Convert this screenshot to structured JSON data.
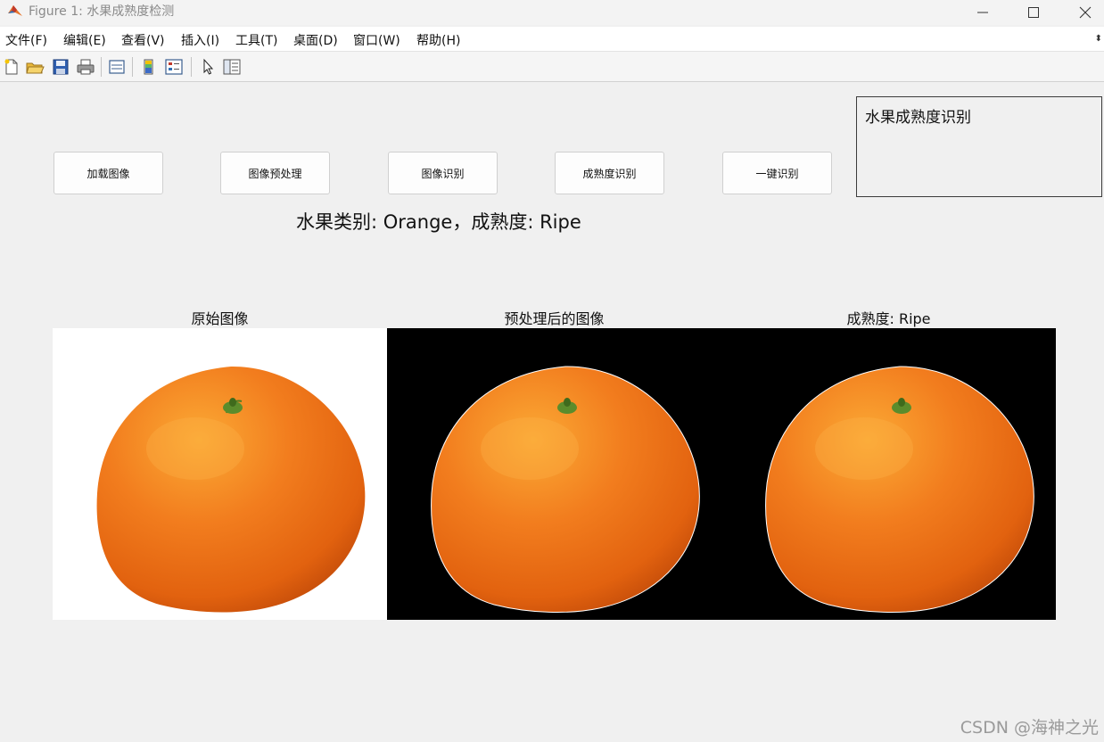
{
  "window": {
    "title": "Figure 1: 水果成熟度检测",
    "logo_icon": "matlab-logo-icon",
    "controls": [
      "minimize-icon",
      "maximize-icon",
      "close-icon"
    ]
  },
  "menu": {
    "items": [
      "文件(F)",
      "编辑(E)",
      "查看(V)",
      "插入(I)",
      "工具(T)",
      "桌面(D)",
      "窗口(W)",
      "帮助(H)"
    ],
    "overflow_glyph": "⬍"
  },
  "toolbar": {
    "icons": [
      "new-figure-icon",
      "open-file-icon",
      "save-icon",
      "print-icon",
      "link-plot-icon",
      "colorbar-icon",
      "legend-icon",
      "pointer-icon",
      "property-editor-icon"
    ]
  },
  "buttons": {
    "load_image": "加载图像",
    "preprocess": "图像预处理",
    "recognize": "图像识别",
    "ripeness": "成熟度识别",
    "one_click": "一键识别"
  },
  "info_box": {
    "text": "水果成熟度识别"
  },
  "result": {
    "text": "水果类别: Orange，成熟度: Ripe"
  },
  "axes": {
    "original_title": "原始图像",
    "preprocessed_title": "预处理后的图像",
    "ripeness_title": "成熟度: Ripe"
  },
  "colors": {
    "orange_fill": "#f07a1c",
    "orange_highlight": "#f9a630",
    "orange_shadow": "#d5550e",
    "stem": "#5a8a2a",
    "background_black": "#000000",
    "background_white": "#ffffff"
  },
  "watermark": {
    "text": "CSDN @海神之光"
  }
}
